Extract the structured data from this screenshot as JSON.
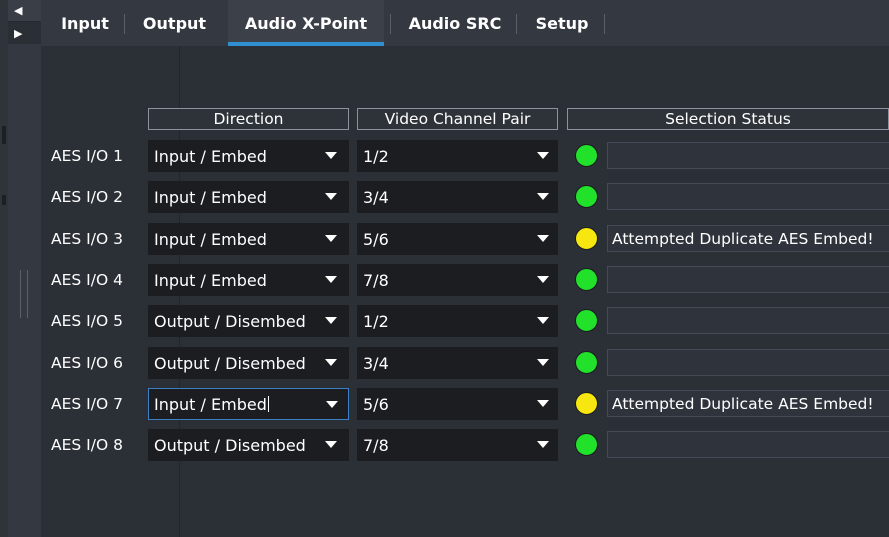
{
  "tabs": [
    {
      "label": "Input",
      "active": false
    },
    {
      "label": "Output",
      "active": false
    },
    {
      "label": "Audio X-Point",
      "active": true
    },
    {
      "label": "Audio SRC",
      "active": false
    },
    {
      "label": "Setup",
      "active": false
    }
  ],
  "side_nav": {
    "up_glyph": "◀",
    "down_glyph": "▶"
  },
  "headers": {
    "direction": "Direction",
    "video_channel_pair": "Video Channel Pair",
    "selection_status": "Selection Status"
  },
  "rows": [
    {
      "label": "AES I/O 1",
      "direction": "Input / Embed",
      "pair": "1/2",
      "led": "green",
      "status": ""
    },
    {
      "label": "AES I/O 2",
      "direction": "Input / Embed",
      "pair": "3/4",
      "led": "green",
      "status": ""
    },
    {
      "label": "AES I/O 3",
      "direction": "Input / Embed",
      "pair": "5/6",
      "led": "yellow",
      "status": "Attempted Duplicate AES Embed!"
    },
    {
      "label": "AES I/O 4",
      "direction": "Input / Embed",
      "pair": "7/8",
      "led": "green",
      "status": ""
    },
    {
      "label": "AES I/O 5",
      "direction": "Output / Disembed",
      "pair": "1/2",
      "led": "green",
      "status": ""
    },
    {
      "label": "AES I/O 6",
      "direction": "Output / Disembed",
      "pair": "3/4",
      "led": "green",
      "status": ""
    },
    {
      "label": "AES I/O 7",
      "direction": "Input / Embed",
      "pair": "5/6",
      "led": "yellow",
      "status": "Attempted Duplicate AES Embed!",
      "focused": true
    },
    {
      "label": "AES I/O 8",
      "direction": "Output / Disembed",
      "pair": "7/8",
      "led": "green",
      "status": ""
    }
  ],
  "colors": {
    "led_green": "#22e12a",
    "led_yellow": "#f7e60f",
    "accent": "#2f8fd1"
  }
}
